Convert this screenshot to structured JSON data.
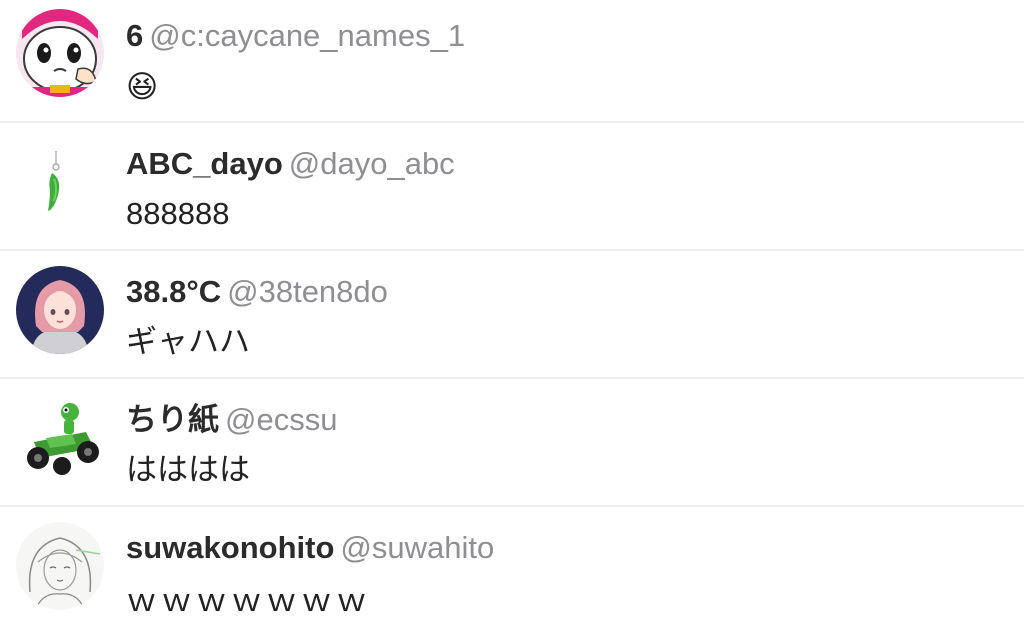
{
  "replies": [
    {
      "name": "6",
      "handle": "@c:caycane_names_1",
      "text": "😆",
      "avatar_icon": "cartoon-face-avatar"
    },
    {
      "name": "ABC_dayo",
      "handle": "@dayo_abc",
      "text": "888888",
      "avatar_icon": "green-charm-avatar"
    },
    {
      "name": "38.8°C",
      "handle": "@38ten8do",
      "text": "ギャハハ",
      "avatar_icon": "pink-hair-girl-avatar"
    },
    {
      "name": "ちり紙",
      "handle": "@ecssu",
      "text": "はははは",
      "avatar_icon": "yoshi-kart-avatar"
    },
    {
      "name": "suwakonohito",
      "handle": "@suwahito",
      "text": "ｗｗｗｗｗｗｗ",
      "avatar_icon": "sketch-girl-avatar"
    }
  ],
  "colors": {
    "name": "#2b2b2b",
    "handle": "#8e8e93",
    "divider": "#eeeeee",
    "background": "#ffffff"
  }
}
